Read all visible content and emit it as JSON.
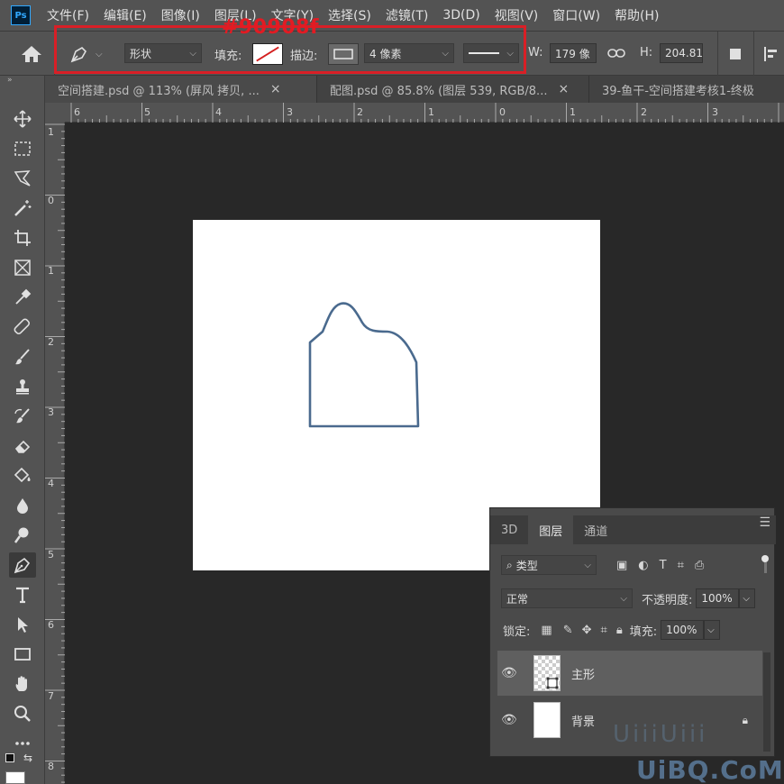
{
  "menubar": {
    "logo": "Ps",
    "items": [
      "文件(F)",
      "编辑(E)",
      "图像(I)",
      "图层(L)",
      "文字(Y)",
      "选择(S)",
      "滤镜(T)",
      "3D(D)",
      "视图(V)",
      "窗口(W)",
      "帮助(H)"
    ]
  },
  "options": {
    "mode": "形状",
    "fill_label": "填充:",
    "stroke_label": "描边:",
    "stroke_width": "4 像素",
    "w_label": "W:",
    "w_value": "179 像",
    "h_label": "H:",
    "h_value": "204.81"
  },
  "annotation": {
    "text": "#90908f",
    "color": "#e31b23"
  },
  "tabs": [
    {
      "label": "空间搭建.psd @ 113% (屏风 拷贝, ...",
      "close": "×"
    },
    {
      "label": "配图.psd @ 85.8% (图层 539, RGB/8...",
      "close": "×"
    },
    {
      "label": "39-鱼干-空间搭建考核1-终极"
    }
  ],
  "ruler_top": [
    "6",
    "5",
    "4",
    "3",
    "2",
    "1",
    "0",
    "1",
    "2",
    "3"
  ],
  "ruler_left": [
    "1",
    "0",
    "1",
    "2",
    "3",
    "4",
    "5",
    "6",
    "7",
    "8"
  ],
  "shape": {
    "stroke_color": "#4a6a8e"
  },
  "layers_panel": {
    "tabs": [
      "3D",
      "图层",
      "通道"
    ],
    "filter_label": "类型",
    "blend_mode": "正常",
    "opacity_label": "不透明度:",
    "opacity_value": "100%",
    "lock_label": "锁定:",
    "fill_label": "填充:",
    "fill_value": "100%",
    "layers": [
      {
        "name": "主形",
        "selected": true
      },
      {
        "name": "背景",
        "locked": true
      }
    ]
  },
  "watermark": {
    "text": "UiBQ.CoM",
    "faint": "UiiiUiii"
  }
}
